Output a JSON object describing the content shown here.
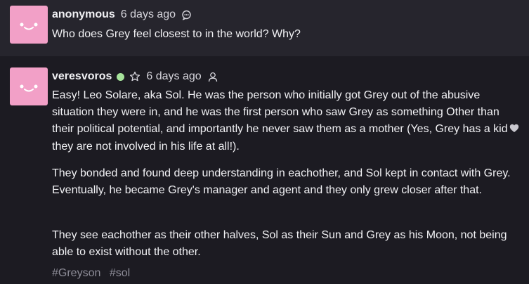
{
  "question": {
    "username": "anonymous",
    "time": "6 days ago",
    "text": "Who does Grey feel closest to in the world? Why?",
    "icon": "speech-bubble-icon"
  },
  "answer": {
    "username": "veresvoros",
    "online_color": "#a6e39b",
    "time": "6 days ago",
    "icons": [
      "online-status-icon",
      "star-icon",
      "person-icon"
    ],
    "paragraphs": {
      "p1_before_heart": "Easy! Leo Solare, aka Sol. He was the person who initially got Grey out of the abusive situation they were in, and he was the first person who saw Grey as something Other than their political potential, and importantly he never saw them as a mother (Yes, Grey has a kid",
      "p1_heart": "🤍",
      "p1_after_heart": " they are not involved in his life at all!).",
      "p2": "They bonded and found deep understanding in eachother, and Sol kept in contact with Grey. Eventually, he became Grey's manager and agent and they only grew closer after that.",
      "p3": "They see eachother as their other halves, Sol as their Sun and Grey as his Moon, not being able to exist without the other."
    },
    "tags": [
      "#Greyson",
      "#sol"
    ]
  },
  "colors": {
    "page_bg": "#1c1b22",
    "question_bg": "#26252d",
    "avatar": "#f2a0c7",
    "text": "#f1f1f4",
    "tag": "#8e8d98"
  }
}
